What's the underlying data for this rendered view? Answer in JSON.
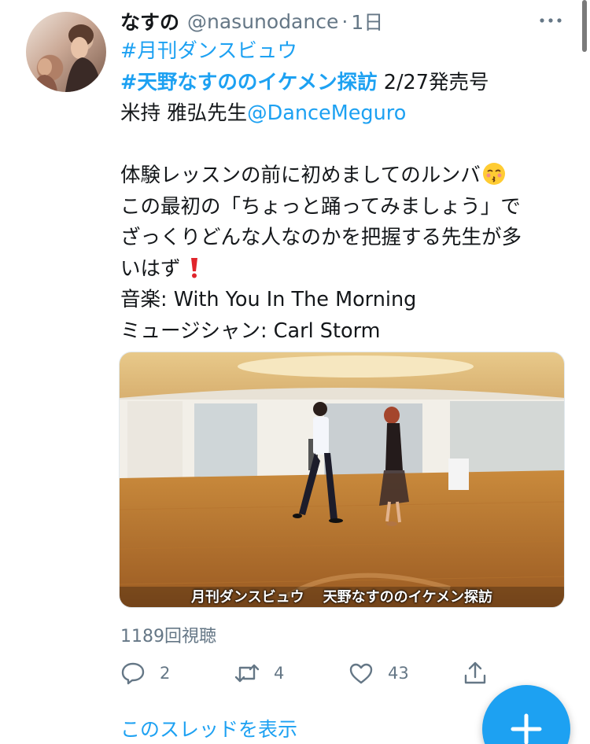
{
  "tweet": {
    "display_name": "なすの",
    "handle": "@nasunodance",
    "separator": "·",
    "time": "1日",
    "lines": {
      "l1": "#月刊ダンスビュウ",
      "l2_tag": "#天野なすののイケメン探訪",
      "l2_rest": " 2/27発売号",
      "l3_text": "米持 雅弘先生",
      "l3_mention": "@DanceMeguro",
      "l4": "体験レッスンの前に初めましてのルンバ",
      "l5": "この最初の「ちょっと踊ってみましょう」で",
      "l6": "ざっくりどんな人なのかを把握する先生が多",
      "l7": "いはず",
      "l8": "音楽: With You In The Morning",
      "l9": "ミュージシャン: Carl Storm"
    },
    "emoji": [
      "kissing-face-emoji",
      "exclamation-mark-emoji"
    ]
  },
  "media": {
    "caption_left": "月刊ダンスビュウ",
    "caption_right": "天野なすののイケメン探訪"
  },
  "stats": {
    "views": "1189回視聴",
    "replies": "2",
    "retweets": "4",
    "likes": "43"
  },
  "thread_link": "このスレッドを表示",
  "colors": {
    "accent": "#1da1f2",
    "muted": "#657786",
    "text": "#14171a"
  }
}
